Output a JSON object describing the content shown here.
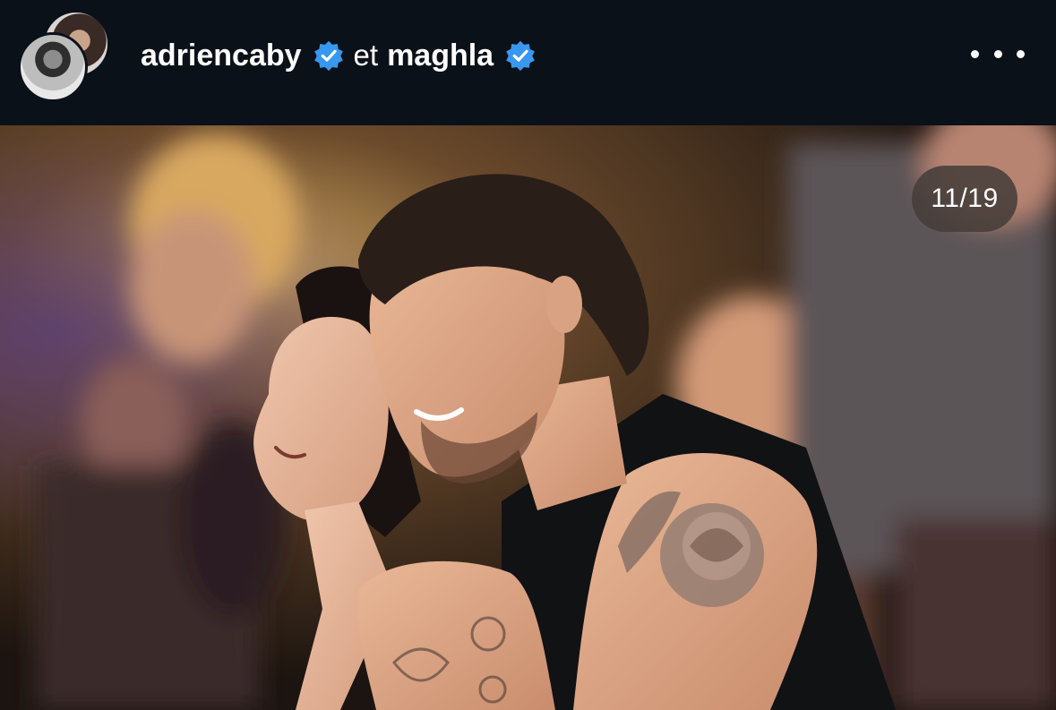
{
  "post_header": {
    "users": [
      {
        "username": "adriencaby",
        "verified": true
      },
      {
        "username": "maghla",
        "verified": true
      }
    ],
    "separator": "et",
    "more_icon": "more-horizontal-icon"
  },
  "carousel": {
    "counter": "11/19"
  },
  "colors": {
    "background": "#0b1118",
    "verified_badge": "#3897f0",
    "text": "#ffffff",
    "counter_pill": "#463e3a"
  }
}
